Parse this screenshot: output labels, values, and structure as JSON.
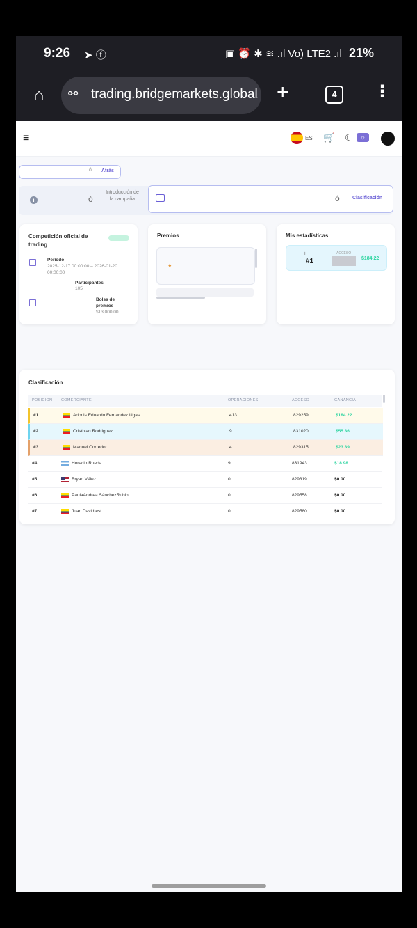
{
  "status_bar": {
    "time": "9:26",
    "left_icons": "➤ ⓕ",
    "right_icons": "▣ ⏰ ✱ ≋ .ıl Vo) LTE2 .ıl",
    "battery": "21%"
  },
  "browser": {
    "url": "trading.bridgemarkets.global/",
    "tab_count": "4",
    "home_glyph": "⌂",
    "plus_glyph": "+",
    "menu_glyph": "⋮",
    "tune_glyph": "⚯"
  },
  "topnav": {
    "menu_glyph": "≡",
    "lang": "ES",
    "cart_glyph": "🛒",
    "moon_glyph": "☾",
    "sun_glyph": "☼"
  },
  "back_button": {
    "accent": "ó",
    "label": "Atrás"
  },
  "steps": {
    "info_glyph": "i",
    "accent": "ó",
    "intro_label": "Introducción de la campaña",
    "ranking_label": "Clasificación"
  },
  "competition_card": {
    "title": "Competición oficial de trading",
    "period_label": "Período",
    "period_value": "2025-12-17 00:00:00 – 2026-01-20 00:00:00",
    "participants_label": "Participantes",
    "participants_value": "105",
    "prize_pool_label": "Bolsa de premios",
    "prize_pool_value": "$13,000.00"
  },
  "prizes_card": {
    "title": "Premios",
    "prize_glyph": "♦"
  },
  "stats_card": {
    "title": "Mis estadísticas",
    "i_glyph": "i",
    "rank": "#1",
    "access_label": "ACCESO",
    "gain": "$184.22"
  },
  "ranking": {
    "title": "Clasificación",
    "columns": [
      "POSICIÓN",
      "COMERCIANTE",
      "OPERACIONES",
      "ACCESO",
      "GANANCIA"
    ],
    "rows": [
      {
        "pos": "#1",
        "name": "Adonis Eduardo Fernández Ugas",
        "ops": "413",
        "acc": "829259",
        "gain": "$184.22"
      },
      {
        "pos": "#2",
        "name": "Cristhian Rodriguez",
        "ops": "9",
        "acc": "831020",
        "gain": "$55.36"
      },
      {
        "pos": "#3",
        "name": "Manuel Corredor",
        "ops": "4",
        "acc": "829315",
        "gain": "$23.39"
      },
      {
        "pos": "#4",
        "name": "Horacio Rueda",
        "ops": "9",
        "acc": "831943",
        "gain": "$18.98"
      },
      {
        "pos": "#5",
        "name": "Bryan Vélez",
        "ops": "0",
        "acc": "829319",
        "gain": "$0.00"
      },
      {
        "pos": "#6",
        "name": "PaulaAndrea SánchezRubio",
        "ops": "0",
        "acc": "829558",
        "gain": "$0.00"
      },
      {
        "pos": "#7",
        "name": "Juan Davidtest",
        "ops": "0",
        "acc": "829580",
        "gain": "$0.00"
      }
    ]
  },
  "colors": {
    "accent": "#6a5fd6",
    "gain_positive": "#2dd4a0",
    "rank_gold": "#f2c42c",
    "rank_cyan": "#6ed4ef",
    "rank_bronze": "#e4a16a"
  }
}
